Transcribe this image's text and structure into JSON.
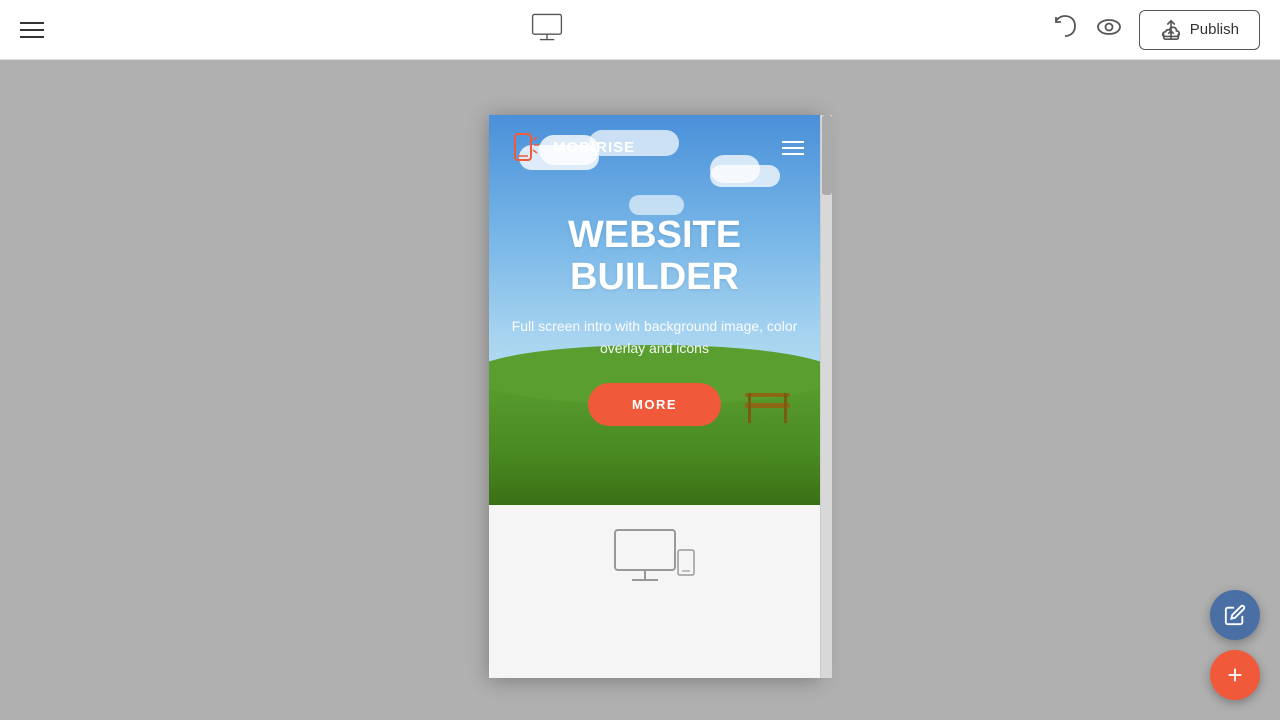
{
  "toolbar": {
    "publish_label": "Publish",
    "menu_icon": "hamburger-menu",
    "monitor_icon": "monitor-icon",
    "undo_icon": "undo-icon",
    "eye_icon": "preview-eye-icon",
    "upload_icon": "upload-cloud-icon"
  },
  "preview": {
    "logo_text": "MOBIRISE",
    "hero_title_line1": "WEBSITE",
    "hero_title_line2": "BUILDER",
    "hero_subtitle": "Full screen intro with background image, color overlay and icons",
    "more_button_label": "MORE"
  },
  "fab": {
    "edit_icon": "pencil-icon",
    "add_icon": "plus-icon"
  }
}
